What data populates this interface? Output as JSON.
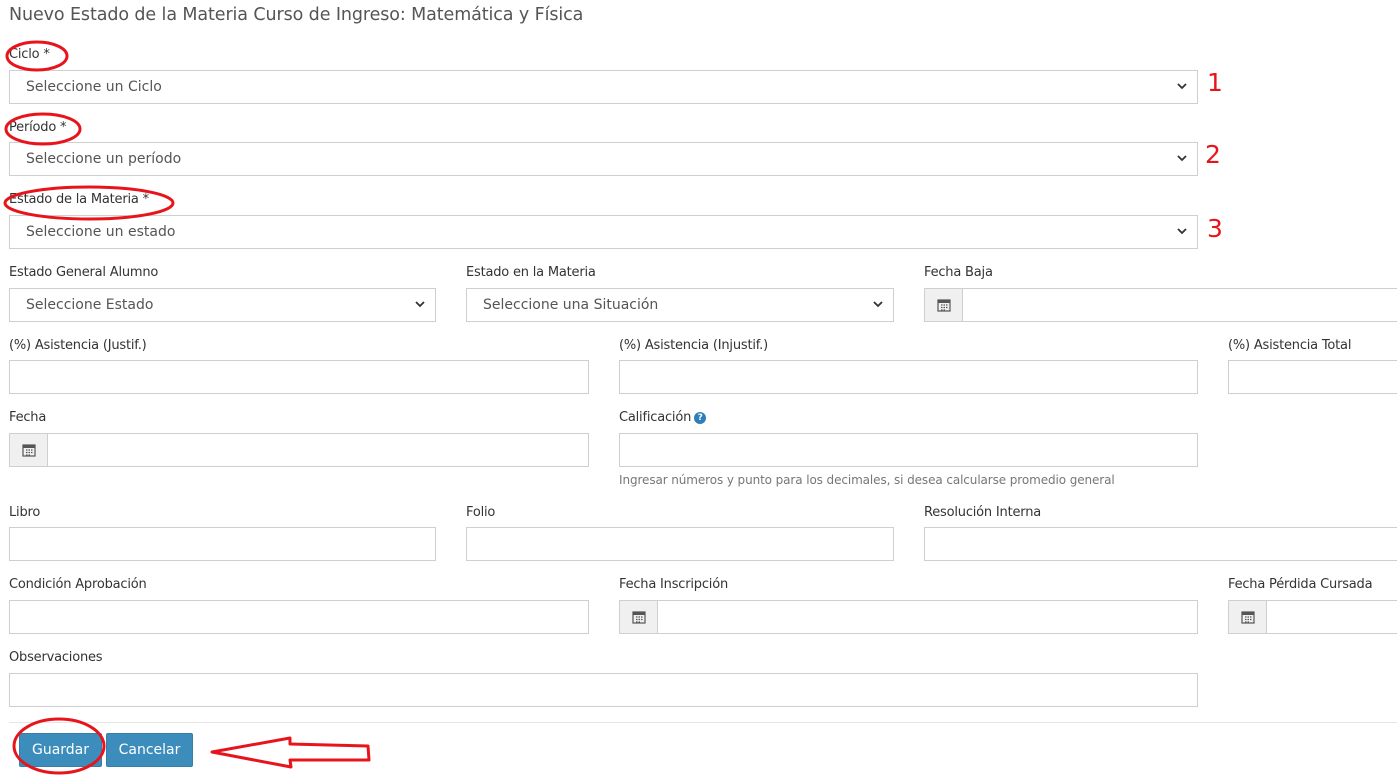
{
  "page": {
    "title": "Nuevo Estado de la Materia Curso de Ingreso: Matemática y Física"
  },
  "fields": {
    "ciclo": {
      "label": "Ciclo *",
      "value": "Seleccione un Ciclo"
    },
    "periodo": {
      "label": "Período *",
      "value": "Seleccione un período"
    },
    "estado_materia_req": {
      "label": "Estado de la Materia *",
      "value": "Seleccione un estado"
    },
    "estado_general_alumno": {
      "label": "Estado General Alumno",
      "value": "Seleccione Estado"
    },
    "estado_en_materia": {
      "label": "Estado en la Materia",
      "value": "Seleccione una Situación"
    },
    "fecha_baja": {
      "label": "Fecha Baja",
      "value": ""
    },
    "asistencia_justif": {
      "label": "(%) Asistencia (Justif.)",
      "value": ""
    },
    "asistencia_injustif": {
      "label": "(%) Asistencia (Injustif.)",
      "value": ""
    },
    "asistencia_total": {
      "label": "(%) Asistencia Total",
      "value": ""
    },
    "fecha": {
      "label": "Fecha",
      "value": ""
    },
    "calificacion": {
      "label": "Calificación",
      "value": "",
      "help_icon": "?",
      "help": "Ingresar números y punto para los decimales, si desea calcularse promedio general"
    },
    "libro": {
      "label": "Libro",
      "value": ""
    },
    "folio": {
      "label": "Folio",
      "value": ""
    },
    "resolucion_interna": {
      "label": "Resolución Interna",
      "value": ""
    },
    "condicion_aprobacion": {
      "label": "Condición Aprobación",
      "value": ""
    },
    "fecha_inscripcion": {
      "label": "Fecha Inscripción",
      "value": ""
    },
    "fecha_perdida_cursada": {
      "label": "Fecha Pérdida Cursada",
      "value": ""
    },
    "observaciones": {
      "label": "Observaciones",
      "value": ""
    }
  },
  "actions": {
    "save_label": "Guardar",
    "cancel_label": "Cancelar"
  },
  "annotations": {
    "num1": "1",
    "num2": "2",
    "num3": "3"
  },
  "icons": {
    "select": "chevron-down-icon",
    "date": "calendar-icon",
    "help": "question-circle-icon",
    "annotation": "hand-drawn-arrow"
  },
  "colors": {
    "primary_button": "#3c8dbc",
    "annotation": "#e8141c",
    "help_icon": "#2c7fb8"
  }
}
